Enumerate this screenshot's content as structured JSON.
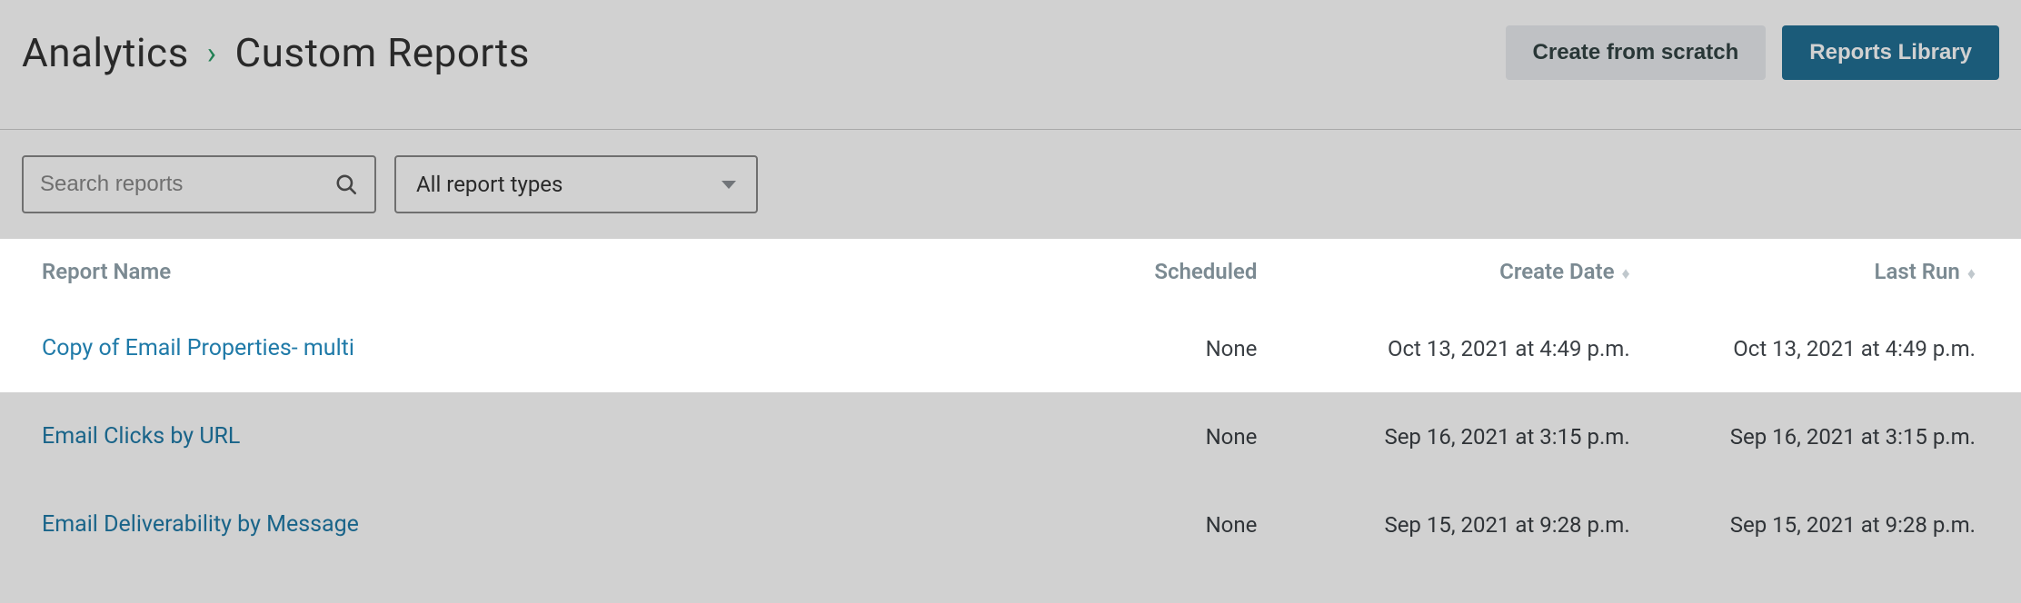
{
  "header": {
    "breadcrumb_root": "Analytics",
    "breadcrumb_current": "Custom Reports",
    "create_from_scratch": "Create from scratch",
    "reports_library": "Reports Library"
  },
  "filters": {
    "search_placeholder": "Search reports",
    "type_dropdown": "All report types"
  },
  "table": {
    "columns": {
      "name": "Report Name",
      "scheduled": "Scheduled",
      "create_date": "Create Date",
      "last_run": "Last Run"
    },
    "rows": [
      {
        "name": "Copy of Email Properties- multi",
        "scheduled": "None",
        "create_date": "Oct 13, 2021 at 4:49 p.m.",
        "last_run": "Oct 13, 2021 at 4:49 p.m.",
        "highlight": true
      },
      {
        "name": "Email Clicks by URL",
        "scheduled": "None",
        "create_date": "Sep 16, 2021 at 3:15 p.m.",
        "last_run": "Sep 16, 2021 at 3:15 p.m.",
        "highlight": false
      },
      {
        "name": "Email Deliverability by Message",
        "scheduled": "None",
        "create_date": "Sep 15, 2021 at 9:28 p.m.",
        "last_run": "Sep 15, 2021 at 9:28 p.m.",
        "highlight": false
      }
    ]
  }
}
